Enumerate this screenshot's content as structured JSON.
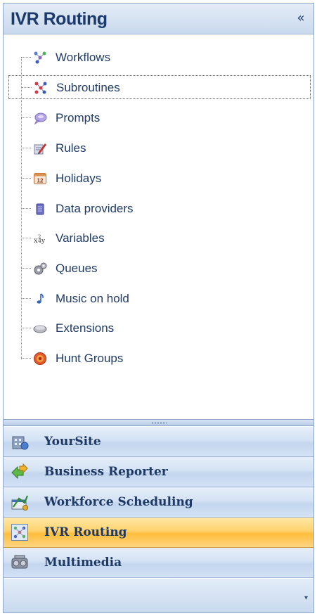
{
  "header": {
    "title": "IVR Routing",
    "collapse_glyph": "«"
  },
  "tree": {
    "items": [
      {
        "label": "Workflows",
        "icon": "workflow-icon"
      },
      {
        "label": "Subroutines",
        "icon": "subroutine-icon",
        "selected": true
      },
      {
        "label": "Prompts",
        "icon": "speech-bubble-icon"
      },
      {
        "label": "Rules",
        "icon": "rules-pencil-icon"
      },
      {
        "label": "Holidays",
        "icon": "calendar-icon"
      },
      {
        "label": "Data providers",
        "icon": "database-icon"
      },
      {
        "label": "Variables",
        "icon": "variable-icon"
      },
      {
        "label": "Queues",
        "icon": "gears-icon"
      },
      {
        "label": "Music on hold",
        "icon": "music-note-icon"
      },
      {
        "label": "Extensions",
        "icon": "phone-icon"
      },
      {
        "label": "Hunt Groups",
        "icon": "target-icon"
      }
    ]
  },
  "nav": {
    "buttons": [
      {
        "label": "YourSite",
        "icon": "building-icon"
      },
      {
        "label": "Business Reporter",
        "icon": "reporter-arrows-icon"
      },
      {
        "label": "Workforce Scheduling",
        "icon": "scheduling-icon"
      },
      {
        "label": "IVR Routing",
        "icon": "ivr-grid-icon",
        "active": true
      },
      {
        "label": "Multimedia",
        "icon": "multimedia-icon"
      }
    ],
    "overflow_glyph": "▾"
  },
  "colors": {
    "header_text": "#1b3a6b",
    "tree_text": "#1f3b66",
    "active_button": "#ffbd3c",
    "button_blue": "#c3d6ee"
  }
}
